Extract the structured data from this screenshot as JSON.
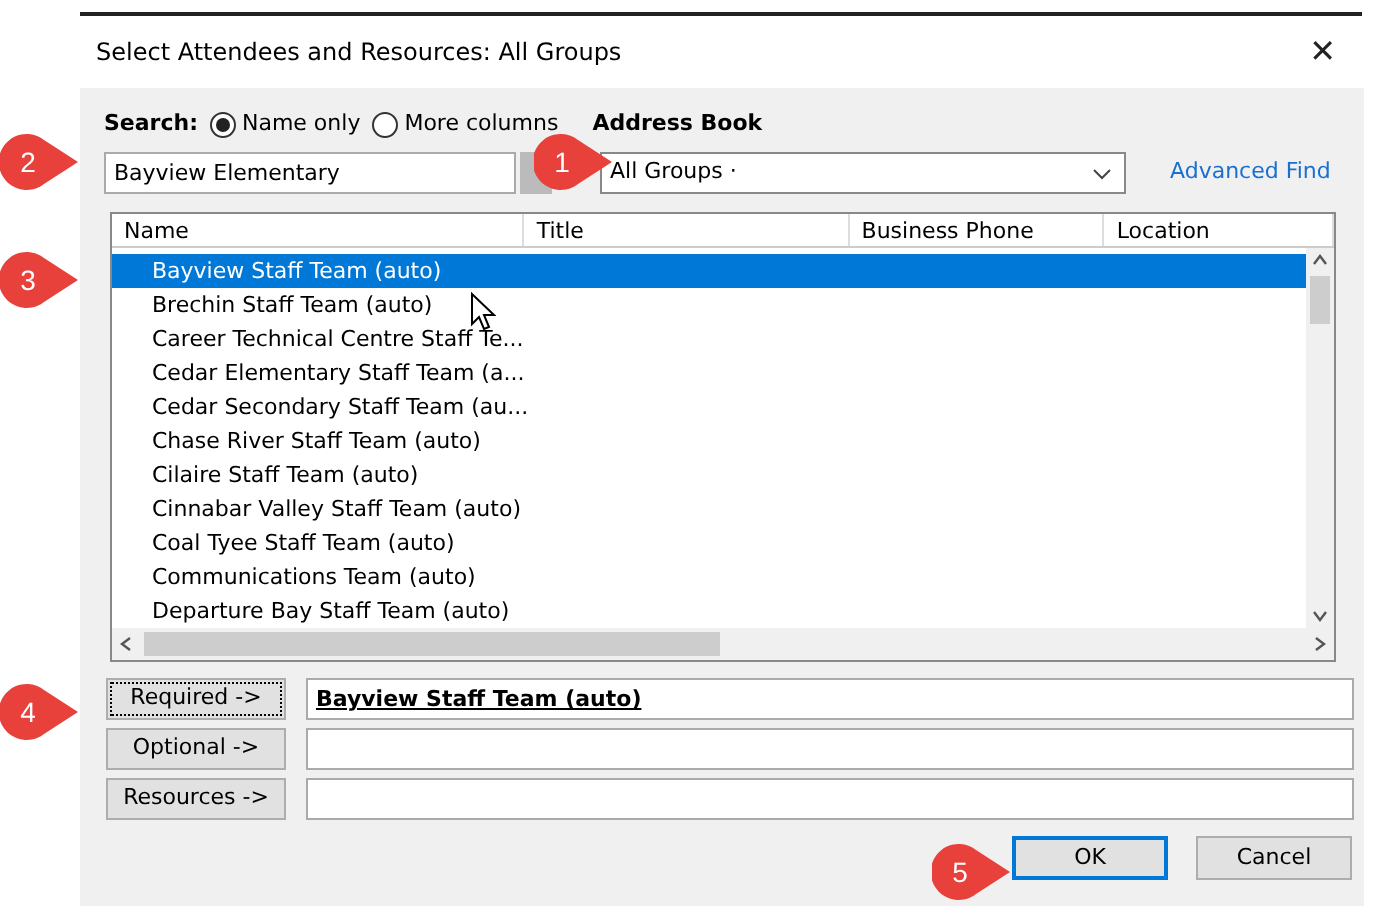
{
  "window": {
    "title": "Select Attendees and Resources: All Groups",
    "close": "✕"
  },
  "search": {
    "label": "Search:",
    "options": [
      {
        "label": "Name only",
        "selected": true
      },
      {
        "label": "More columns",
        "selected": false
      }
    ],
    "value": "Bayview Elementary",
    "callout": "2"
  },
  "address_book": {
    "label": "Address Book",
    "value": "All Groups ·",
    "advanced_find": "Advanced Find",
    "callout": "1"
  },
  "table": {
    "columns": [
      "Name",
      "Title",
      "Business Phone",
      "Location"
    ],
    "rows": [
      {
        "name": "Bayview Staff Team (auto)",
        "selected": true,
        "callout": "3"
      },
      {
        "name": "Brechin Staff Team (auto)",
        "selected": false
      },
      {
        "name": "Career Technical Centre Staff Te...",
        "selected": false
      },
      {
        "name": "Cedar Elementary Staff Team (a...",
        "selected": false
      },
      {
        "name": "Cedar Secondary Staff Team (au...",
        "selected": false
      },
      {
        "name": "Chase River Staff Team (auto)",
        "selected": false
      },
      {
        "name": "Cilaire Staff Team (auto)",
        "selected": false
      },
      {
        "name": "Cinnabar Valley Staff Team (auto)",
        "selected": false
      },
      {
        "name": "Coal Tyee Staff Team (auto)",
        "selected": false
      },
      {
        "name": "Communications Team (auto)",
        "selected": false
      },
      {
        "name": "Departure Bay Staff Team (auto)",
        "selected": false
      }
    ]
  },
  "recipients": [
    {
      "button": "Required ->",
      "value": "Bayview Staff Team (auto)",
      "focused": true,
      "callout": "4"
    },
    {
      "button": "Optional ->",
      "focused": false
    },
    {
      "button": "Resources ->",
      "focused": false
    }
  ],
  "buttons": [
    {
      "label": "OK",
      "default": true,
      "callout": "5"
    },
    {
      "label": "Cancel",
      "default": false
    }
  ]
}
